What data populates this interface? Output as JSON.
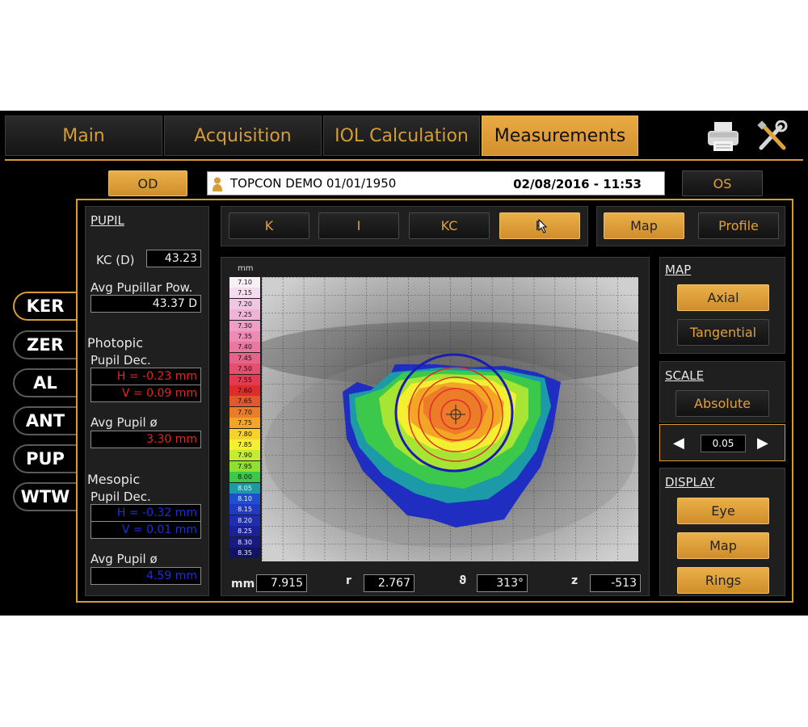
{
  "tabs": [
    {
      "label": "Main",
      "active": false
    },
    {
      "label": "Acquisition",
      "active": false
    },
    {
      "label": "IOL Calculation",
      "active": false
    },
    {
      "label": "Measurements",
      "active": true
    }
  ],
  "toolbar": {
    "print_icon": "printer-icon",
    "tools_icon": "tools-icon"
  },
  "eye": {
    "od_label": "OD",
    "os_label": "OS"
  },
  "patient": {
    "name": "TOPCON DEMO 01/01/1950",
    "datetime": "02/08/2016 - 11:53"
  },
  "side_tabs": [
    {
      "label": "KER",
      "active": true
    },
    {
      "label": "ZER",
      "active": false
    },
    {
      "label": "AL",
      "active": false
    },
    {
      "label": "ANT",
      "active": false
    },
    {
      "label": "PUP",
      "active": false
    },
    {
      "label": "WTW",
      "active": false
    }
  ],
  "pupil": {
    "section": "PUPIL",
    "kc_label": "KC (D)",
    "kc_value": "43.23",
    "avg_pow_label": "Avg Pupillar Pow.",
    "avg_pow_value": "43.37 D",
    "photopic": {
      "title": "Photopic",
      "dec_label": "Pupil Dec.",
      "h": "H = -0.23 mm",
      "v": "V = 0.09 mm",
      "avg_label": "Avg Pupil ø",
      "avg_value": "3.30 mm"
    },
    "mesopic": {
      "title": "Mesopic",
      "dec_label": "Pupil Dec.",
      "h": "H = -0.32 mm",
      "v": "V = 0.01 mm",
      "avg_label": "Avg Pupil ø",
      "avg_value": "4.59 mm"
    }
  },
  "map_modes": [
    {
      "label": "K",
      "active": false
    },
    {
      "label": "I",
      "active": false
    },
    {
      "label": "KC",
      "active": false
    },
    {
      "label": "R",
      "active": true
    }
  ],
  "view_modes": [
    {
      "label": "Map",
      "active": true
    },
    {
      "label": "Profile",
      "active": false
    }
  ],
  "color_scale": {
    "unit": "mm",
    "values": [
      "7.10",
      "7.15",
      "7.20",
      "7.25",
      "7.30",
      "7.35",
      "7.40",
      "7.45",
      "7.50",
      "7.55",
      "7.60",
      "7.65",
      "7.70",
      "7.75",
      "7.80",
      "7.85",
      "7.90",
      "7.95",
      "8.00",
      "8.05",
      "8.10",
      "8.15",
      "8.20",
      "8.25",
      "8.30",
      "8.35"
    ],
    "colors": [
      "#f7f0f7",
      "#f2dcee",
      "#f0c7e3",
      "#efb3d6",
      "#ee9fc6",
      "#ec8bb4",
      "#ea779f",
      "#e8638a",
      "#e64f6d",
      "#e43a4f",
      "#e02b2b",
      "#e5562a",
      "#ec7c27",
      "#f3a626",
      "#f7d12c",
      "#f5ef32",
      "#c4ec30",
      "#8fe032",
      "#3cc84a",
      "#1c9aa8",
      "#1f4fd0",
      "#1f3bc3",
      "#1f2eb0",
      "#1b2299",
      "#171a7e",
      "#121463"
    ]
  },
  "readout": {
    "mm_label": "mm",
    "mm_value": "7.915",
    "r_label": "r",
    "r_value": "2.767",
    "theta_label": "ϑ",
    "theta_value": "313°",
    "z_label": "z",
    "z_value": "-513"
  },
  "map_section": {
    "title": "MAP",
    "axial": "Axial",
    "tangential": "Tangential"
  },
  "scale_section": {
    "title": "SCALE",
    "absolute": "Absolute",
    "step": "0.05"
  },
  "display_section": {
    "title": "DISPLAY",
    "eye": "Eye",
    "map": "Map",
    "rings": "Rings"
  },
  "colors": {
    "accent": "#d69c35",
    "background": "#000000"
  }
}
